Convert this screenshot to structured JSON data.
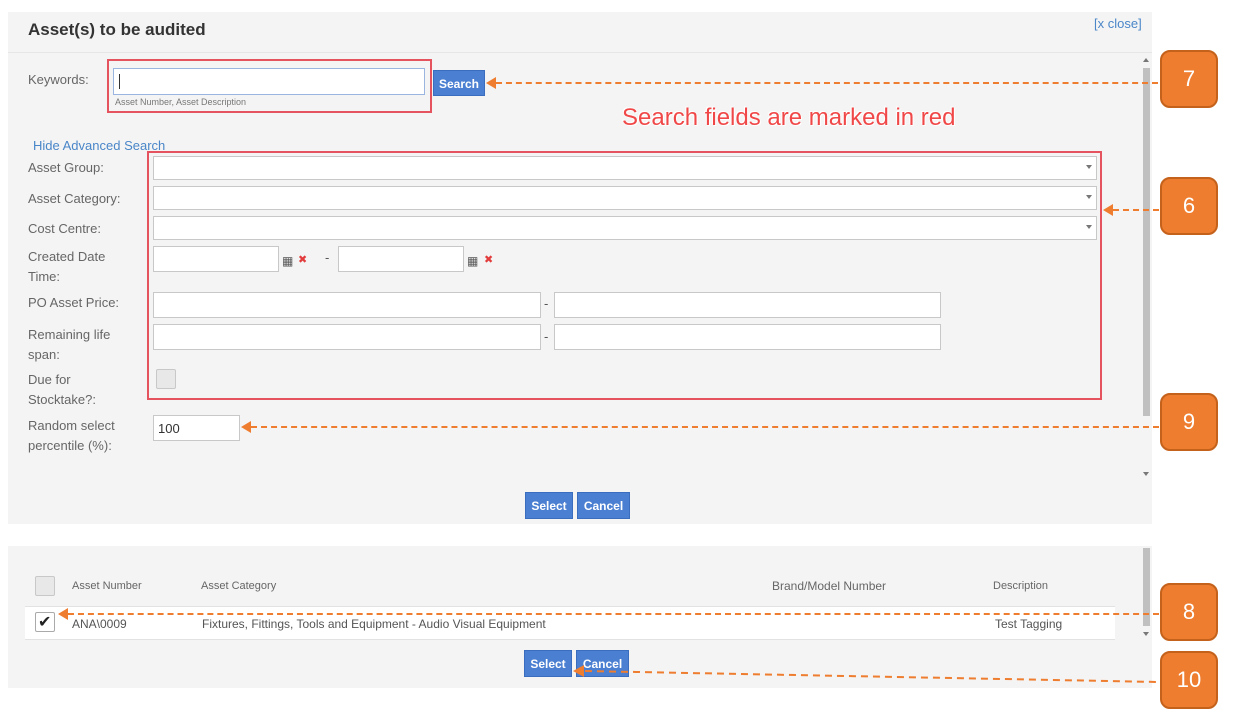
{
  "dialog": {
    "title": "Asset(s) to be audited",
    "close_label": "[x close]"
  },
  "search": {
    "keywords_label": "Keywords:",
    "keywords_value": "",
    "keywords_hint": "Asset Number, Asset Description",
    "search_button": "Search",
    "advanced_toggle": "Hide Advanced Search"
  },
  "annotation_text": "Search fields are marked in red",
  "filters": {
    "asset_group_label": "Asset Group:",
    "asset_category_label": "Asset Category:",
    "cost_centre_label": "Cost Centre:",
    "created_date_label_1": "Created Date",
    "created_date_label_2": "Time:",
    "date_separator": "-",
    "po_price_label": "PO Asset Price:",
    "price_separator": "-",
    "remaining_life_label_1": "Remaining life",
    "remaining_life_label_2": "span:",
    "life_separator": "-",
    "due_stocktake_label_1": "Due for",
    "due_stocktake_label_2": "Stocktake?:",
    "random_label_1": "Random select",
    "random_label_2": "percentile (%):",
    "random_value": "100"
  },
  "top_actions": {
    "select": "Select",
    "cancel": "Cancel"
  },
  "results": {
    "columns": [
      "Asset Number",
      "Asset Category",
      "Brand/Model Number",
      "Description"
    ],
    "rows": [
      {
        "checked": true,
        "asset_number": "ANA\\0009",
        "asset_category": "Fixtures, Fittings, Tools and Equipment - Audio Visual Equipment",
        "brand_model": "",
        "description": "Test Tagging"
      }
    ],
    "select": "Select",
    "cancel": "Cancel"
  },
  "callouts": {
    "c7": "7",
    "c6": "6",
    "c9": "9",
    "c8": "8",
    "c10": "10"
  },
  "colors": {
    "accent_button": "#4a7fd1",
    "highlight_red": "#e5545e",
    "callout_orange": "#ee7d2f"
  }
}
